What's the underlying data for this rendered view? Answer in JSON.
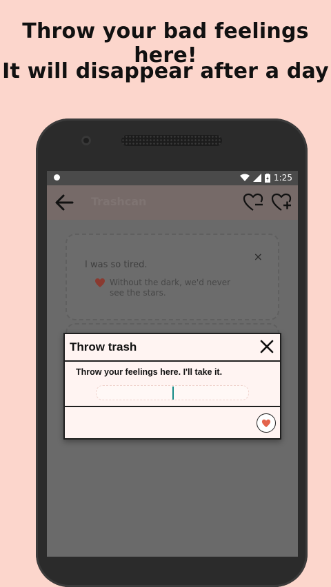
{
  "promo": {
    "line1": "Throw your bad feelings here!",
    "line2": "It will disappear after a day"
  },
  "status_bar": {
    "time": "1:25"
  },
  "app_bar": {
    "title": "Trashcan",
    "back_icon": "back-arrow-icon",
    "icons": [
      "heart-minus-icon",
      "heart-plus-icon"
    ]
  },
  "card": {
    "text": "I was so tired.",
    "reply": "Without the dark, we'd never see the stars.",
    "close_symbol": "×",
    "heart_color": "#8a3a30"
  },
  "dialog": {
    "title": "Throw trash",
    "prompt": "Throw your feelings here. I'll take it.",
    "input_value": "",
    "accent_heart": "#e4644c"
  }
}
